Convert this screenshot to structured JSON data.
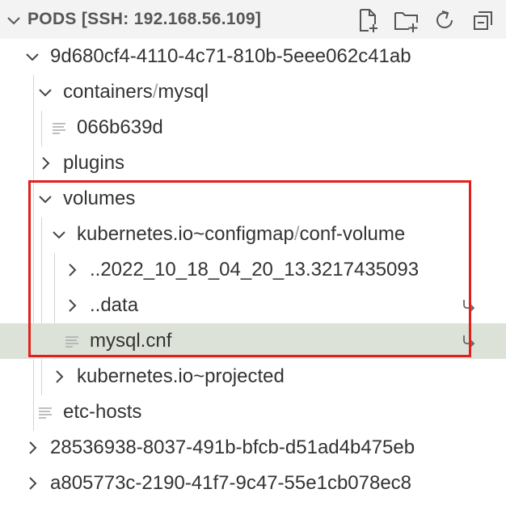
{
  "header": {
    "title": "PODS [SSH: 192.168.56.109]",
    "actions": [
      {
        "icon": "new-file-icon"
      },
      {
        "icon": "new-folder-icon"
      },
      {
        "icon": "refresh-icon"
      },
      {
        "icon": "collapse-all-icon"
      }
    ]
  },
  "tree": {
    "pod1": "9d680cf4-4110-4c71-810b-5eee062c41ab",
    "containers": "containers",
    "containers_sep": "/",
    "containers_sub": "mysql",
    "container_file": "066b639d",
    "plugins": "plugins",
    "volumes": "volumes",
    "configmap": "kubernetes.io~configmap",
    "configmap_sep": "/",
    "configmap_sub": "conf-volume",
    "timestamp_dir": "..2022_10_18_04_20_13.3217435093",
    "data_dir": "..data",
    "mysql_cnf": "mysql.cnf",
    "projected": "kubernetes.io~projected",
    "etc_hosts": "etc-hosts",
    "pod2": "28536938-8037-491b-bfcb-d51ad4b475eb",
    "pod3": "a805773c-2190-41f7-9c47-55e1cb078ec8"
  },
  "colors": {
    "selected_row": "#dde2d8",
    "highlight_border": "#e0201c",
    "header_bg": "#f3f3f3"
  }
}
